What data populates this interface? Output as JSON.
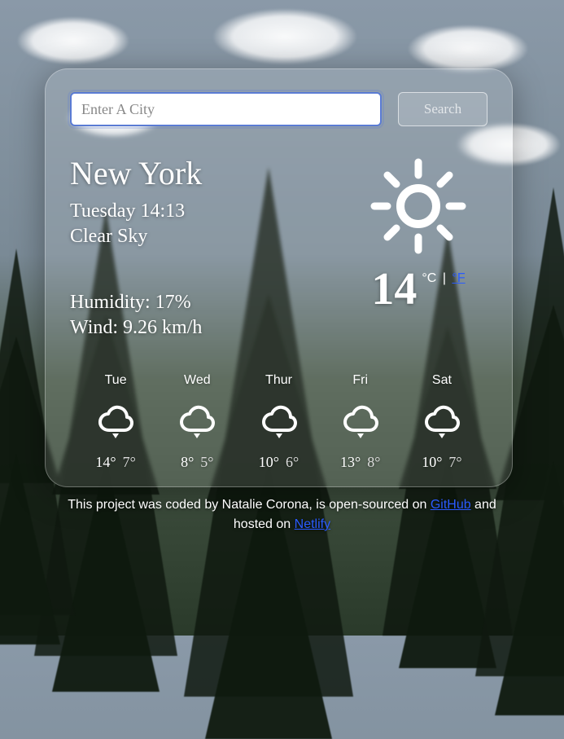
{
  "search": {
    "placeholder": "Enter A City",
    "button": "Search"
  },
  "current": {
    "city": "New York",
    "datetime": "Tuesday 14:13",
    "condition": "Clear Sky",
    "humidity_label": "Humidity:",
    "humidity_value": "17%",
    "wind_label": "Wind:",
    "wind_value": "9.26 km/h",
    "temp": "14",
    "unit_c": "°C",
    "unit_sep": "|",
    "unit_f": "°F"
  },
  "forecast": [
    {
      "day": "Tue",
      "hi": "14°",
      "lo": "7°"
    },
    {
      "day": "Wed",
      "hi": "8°",
      "lo": "5°"
    },
    {
      "day": "Thur",
      "hi": "10°",
      "lo": "6°"
    },
    {
      "day": "Fri",
      "hi": "13°",
      "lo": "8°"
    },
    {
      "day": "Sat",
      "hi": "10°",
      "lo": "7°"
    }
  ],
  "footer": {
    "pre": "This project was coded by Natalie Corona, is open-sourced on ",
    "link1": "GitHub",
    "mid": " and hosted on ",
    "link2": "Netlify"
  },
  "icons": {
    "sun": "sun-icon",
    "cloud": "cloud-icon"
  }
}
